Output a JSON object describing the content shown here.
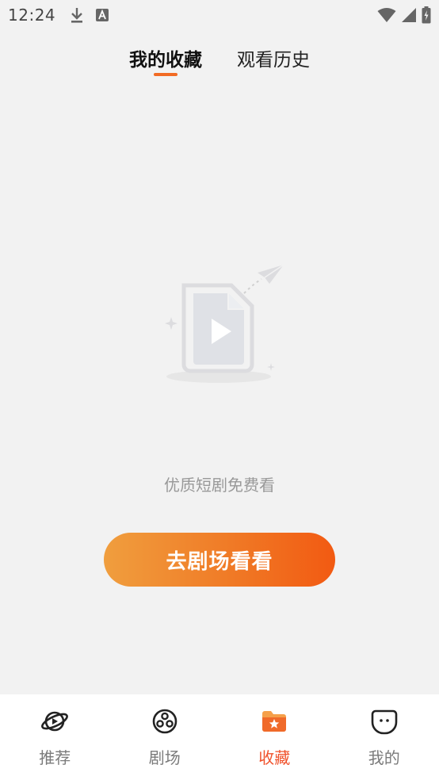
{
  "status_bar": {
    "time": "12:24",
    "icons": [
      "download-icon",
      "keyboard-a-icon",
      "wifi-icon",
      "signal-icon",
      "battery-charging-icon"
    ]
  },
  "tabs": [
    {
      "label": "我的收藏",
      "active": true
    },
    {
      "label": "观看历史",
      "active": false
    }
  ],
  "empty_state": {
    "illustration": "video-file-paper-plane-illustration",
    "message": "优质短剧免费看",
    "button_label": "去剧场看看"
  },
  "bottom_nav": [
    {
      "label": "推荐",
      "icon": "planet-icon",
      "active": false
    },
    {
      "label": "剧场",
      "icon": "film-reel-icon",
      "active": false
    },
    {
      "label": "收藏",
      "icon": "folder-star-icon",
      "active": true
    },
    {
      "label": "我的",
      "icon": "face-icon",
      "active": false
    }
  ],
  "colors": {
    "accent": "#f26b24",
    "active_nav": "#f0522c",
    "background": "#f2f2f2"
  }
}
